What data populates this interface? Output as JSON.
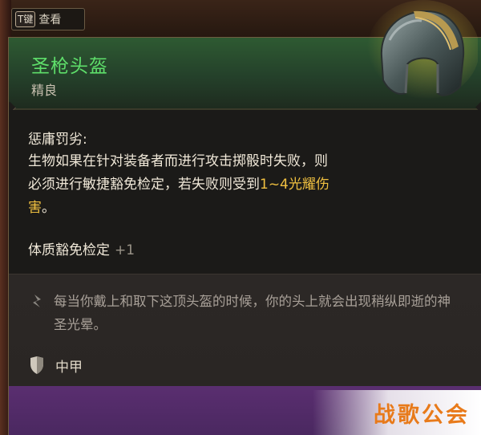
{
  "hint": {
    "key": "T键",
    "label": "查看"
  },
  "item": {
    "name": "圣枪头盔",
    "rarity": "精良",
    "feature_title": "惩庸罚劣:",
    "feature_desc_1": "生物如果在针对装备者而进行攻击掷骰时失败，则必须进行敏捷豁免检定，若失败则受到",
    "feature_damage": "1~4光耀伤害",
    "feature_desc_end": "。",
    "bonus_label": "体质豁免检定",
    "bonus_value": "+1",
    "lore": "每当你戴上和取下这顶头盔的时候，你的头上就会出现稍纵即逝的神圣光晕。",
    "armor_type": "中甲"
  },
  "watermark": "战歌公会",
  "colors": {
    "name_green": "#5ede6a",
    "highlight_gold": "#f0c040",
    "header_green": "#2e5a32",
    "footer_purple": "#5a2e70",
    "watermark_orange": "#e87a1a"
  },
  "icons": [
    "helmet-icon",
    "lore-scroll-icon",
    "shield-icon"
  ]
}
